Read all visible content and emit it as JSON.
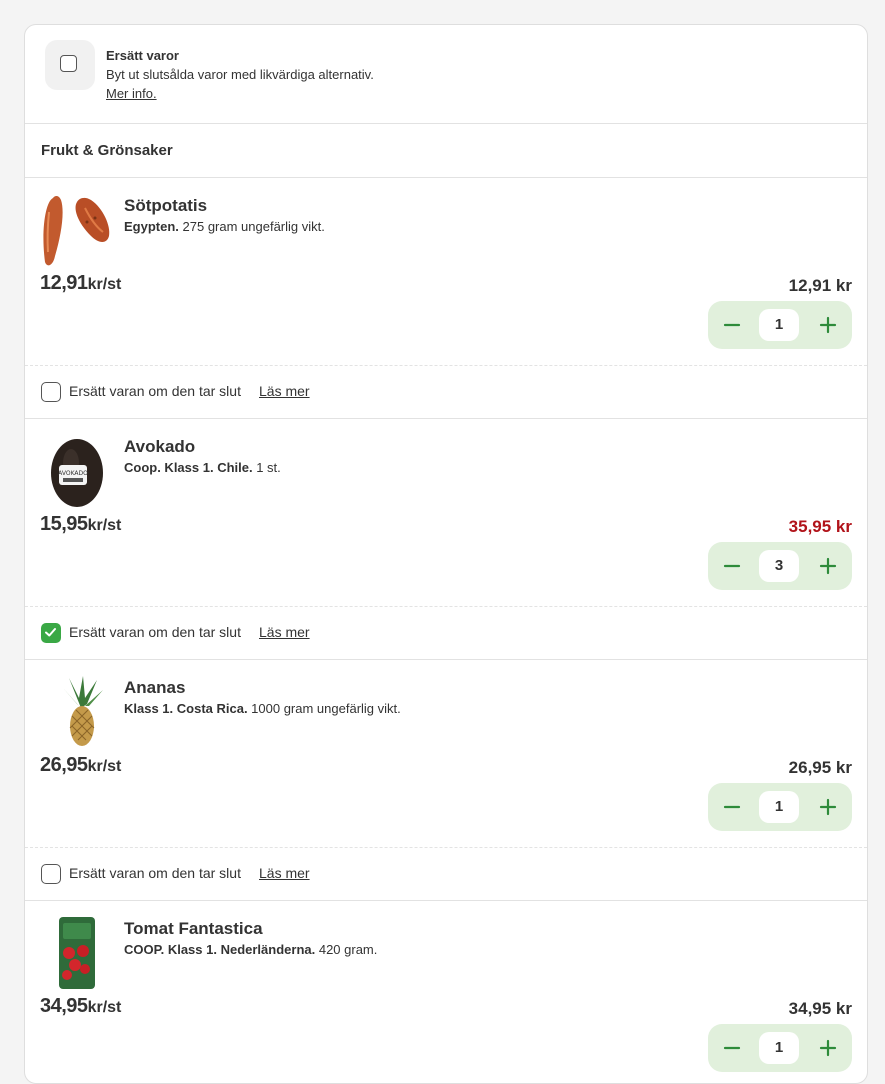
{
  "substitute": {
    "title": "Ersätt varor",
    "description": "Byt ut slutsålda varor med likvärdiga alternativ.",
    "link": "Mer info."
  },
  "section": {
    "title": "Frukt & Grönsaker"
  },
  "products": [
    {
      "name": "Sötpotatis",
      "desc_bold": "Egypten.",
      "desc_rest": " 275 gram ungefärlig vikt.",
      "unit_price": "12,91",
      "unit": "kr/st",
      "total": "12,91 kr",
      "qty": "1",
      "replace_checked": false,
      "replace_label": "Ersätt varan om den tar slut",
      "replace_link": "Läs mer"
    },
    {
      "name": "Avokado",
      "desc_bold": "Coop. Klass 1. Chile.",
      "desc_rest": " 1 st.",
      "unit_price": "15,95",
      "unit": "kr/st",
      "total": "35,95 kr",
      "total_color": "#b1131a",
      "qty": "3",
      "replace_checked": true,
      "replace_label": "Ersätt varan om den tar slut",
      "replace_link": "Läs mer",
      "image_label": "AVOKADO"
    },
    {
      "name": "Ananas",
      "desc_bold": "Klass 1. Costa Rica.",
      "desc_rest": " 1000 gram ungefärlig vikt.",
      "unit_price": "26,95",
      "unit": "kr/st",
      "total": "26,95 kr",
      "qty": "1",
      "replace_checked": false,
      "replace_label": "Ersätt varan om den tar slut",
      "replace_link": "Läs mer"
    },
    {
      "name": "Tomat Fantastica",
      "desc_bold": "COOP. Klass 1. Nederländerna.",
      "desc_rest": " 420 gram.",
      "unit_price": "34,95",
      "unit": "kr/st",
      "total": "34,95 kr",
      "qty": "1"
    }
  ],
  "colors": {
    "accent_green": "#3aa845",
    "stepper_bg": "#e1f0dc",
    "price_red": "#b1131a"
  },
  "icons": {
    "minus": "minus-icon",
    "plus": "plus-icon",
    "check": "checkmark-icon"
  }
}
